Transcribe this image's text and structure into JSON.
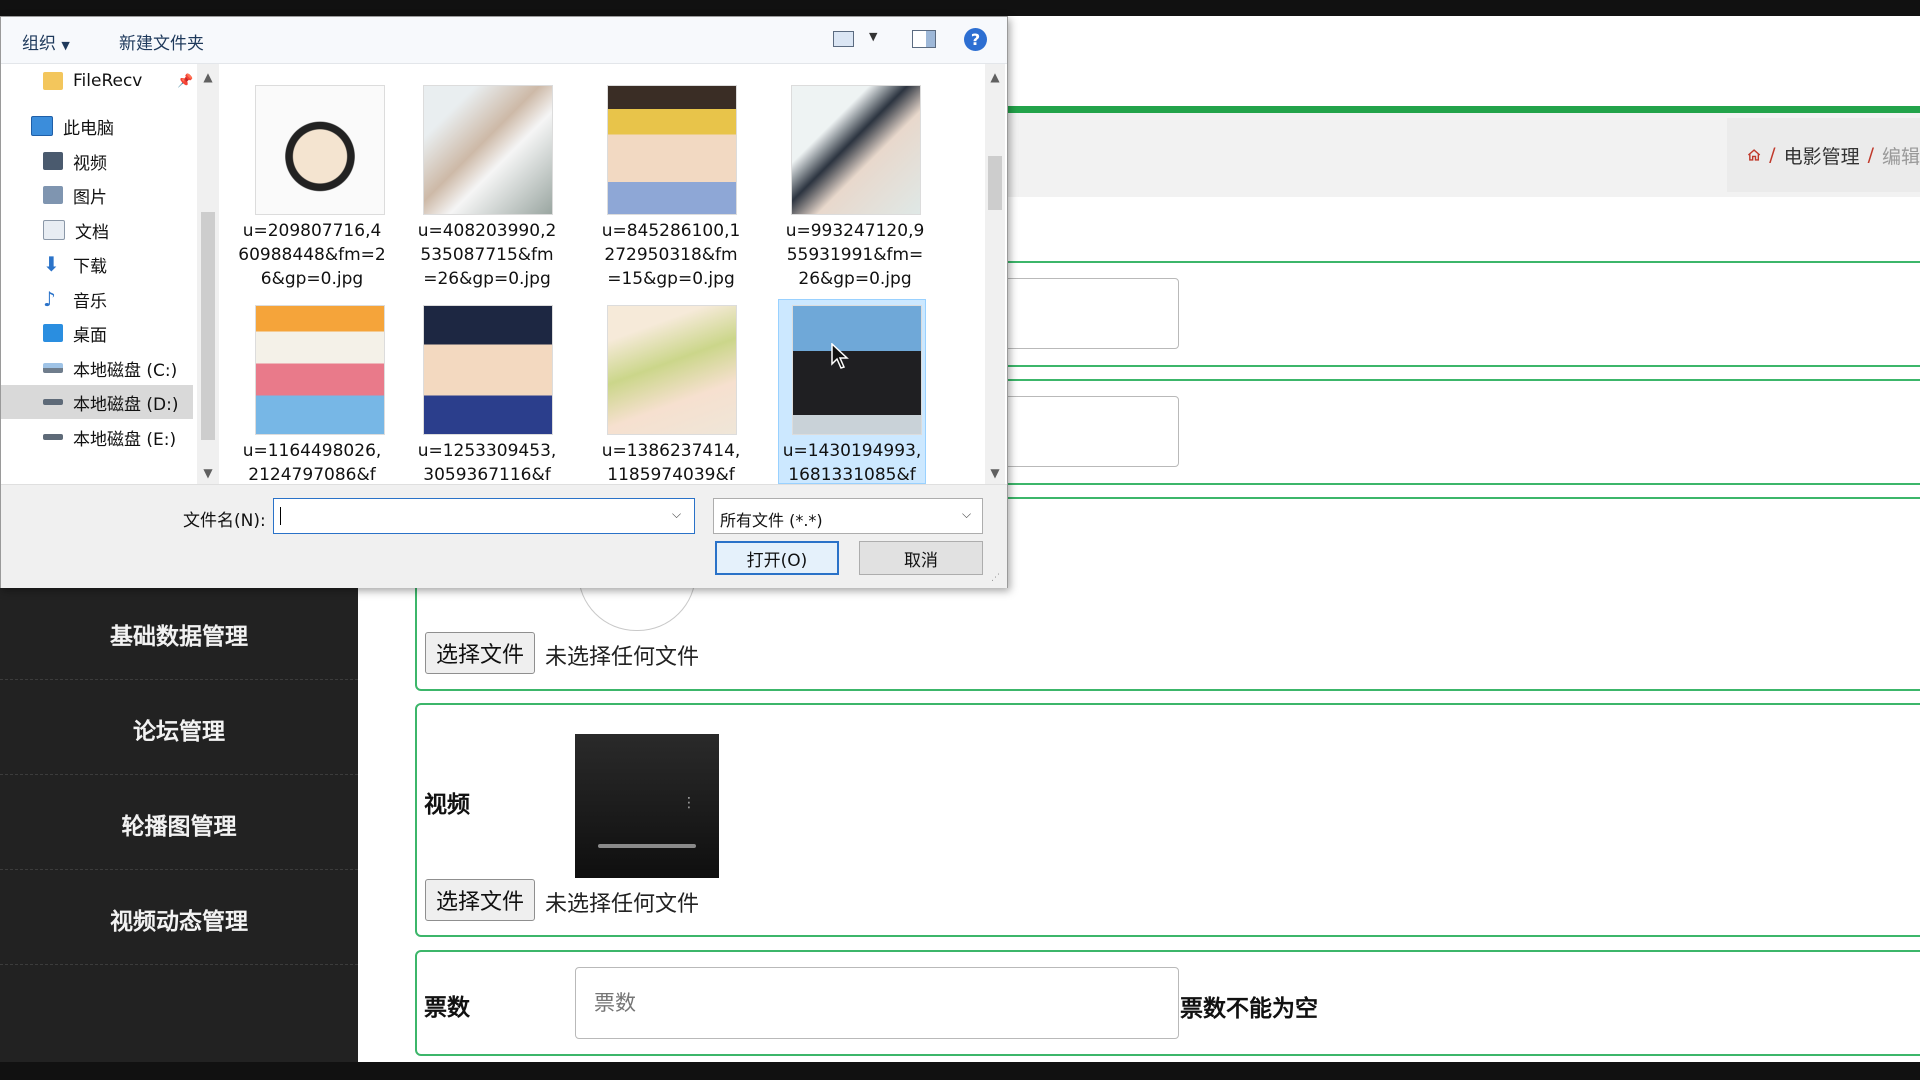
{
  "dialog": {
    "toolbar": {
      "organize": "组织",
      "new_folder": "新建文件夹",
      "help": "?"
    },
    "nav": [
      {
        "label": "FileRecv",
        "icon": "folder-icon"
      },
      {
        "label": "此电脑",
        "icon": "computer-icon"
      },
      {
        "label": "视频",
        "icon": "video-folder-icon"
      },
      {
        "label": "图片",
        "icon": "pictures-folder-icon"
      },
      {
        "label": "文档",
        "icon": "documents-folder-icon"
      },
      {
        "label": "下载",
        "icon": "download-icon"
      },
      {
        "label": "音乐",
        "icon": "music-icon"
      },
      {
        "label": "桌面",
        "icon": "desktop-icon"
      },
      {
        "label": "本地磁盘 (C:)",
        "icon": "drive-icon"
      },
      {
        "label": "本地磁盘 (D:)",
        "icon": "drive-icon"
      },
      {
        "label": "本地磁盘 (E:)",
        "icon": "drive-icon"
      }
    ],
    "files": [
      {
        "name": "u=209807716,4\n60988448&fm=2\n6&gp=0.jpg",
        "thumb": "cartoon-boy-thumbnail"
      },
      {
        "name": "u=408203990,2\n535087715&fm\n=26&gp=0.jpg",
        "thumb": "portrait-flowers-thumbnail"
      },
      {
        "name": "u=845286100,1\n272950318&fm\n=15&gp=0.jpg",
        "thumb": "anime-boy-yellow-hat-thumbnail"
      },
      {
        "name": "u=993247120,9\n55931991&fm=\n26&gp=0.jpg",
        "thumb": "woman-portrait-thumbnail"
      },
      {
        "name": "u=1164498026,\n2124797086&f",
        "thumb": "cartoon-backpack-thumbnail"
      },
      {
        "name": "u=1253309453,\n3059367116&f",
        "thumb": "anime-detective-thumbnail"
      },
      {
        "name": "u=1386237414,\n1185974039&f",
        "thumb": "anime-girl-thumbnail"
      },
      {
        "name": "u=1430194993,\n1681331085&f",
        "thumb": "man-beach-thumbnail"
      }
    ],
    "filename_label": "文件名(N):",
    "filename_value": "",
    "filetype_value": "所有文件 (*.*)",
    "open_button": "打开(O)",
    "cancel_button": "取消"
  },
  "app": {
    "breadcrumb": {
      "item1": "电影管理",
      "item2": "编辑"
    },
    "sidebar": [
      "基础数据管理",
      "论坛管理",
      "轮播图管理",
      "视频动态管理"
    ],
    "form": {
      "choose_file": "选择文件",
      "no_file": "未选择任何文件",
      "video_label": "视频",
      "votes_label": "票数",
      "votes_placeholder": "票数",
      "votes_error": "票数不能为空"
    },
    "colors": {
      "accent": "#3cb66a",
      "sidebar": "#222222"
    }
  }
}
